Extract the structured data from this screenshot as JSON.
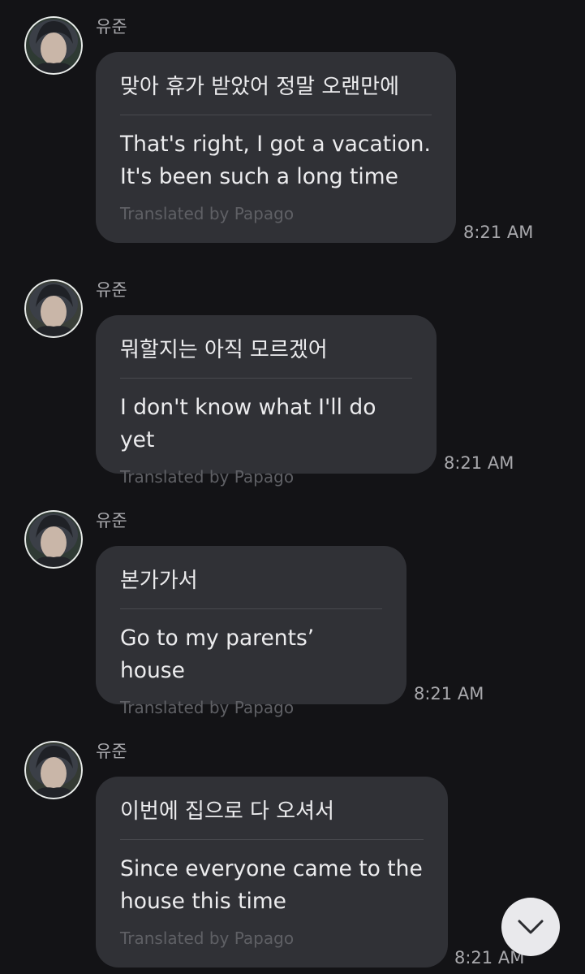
{
  "messages": [
    {
      "sender": "유준",
      "original": "맞아 휴가 받았어 정말 오랜만에",
      "translated_lines": [
        "That's right, I got a vacation.",
        "It's been such a long time"
      ],
      "credit": "Translated by Papago",
      "time": "8:21 AM"
    },
    {
      "sender": "유준",
      "original": "뭐할지는 아직 모르겠어",
      "translated_lines": [
        "I don't know what I'll do yet"
      ],
      "credit": "Translated by Papago",
      "time": "8:21 AM"
    },
    {
      "sender": "유준",
      "original": "본가가서",
      "translated_lines": [
        "Go to my parents’ house"
      ],
      "credit": "Translated by Papago",
      "time": "8:21 AM"
    },
    {
      "sender": "유준",
      "original": "이번에 집으로 다 오셔서",
      "translated_lines": [
        "Since everyone came to the",
        "house this time"
      ],
      "credit": "Translated by Papago",
      "time": "8:21 AM"
    }
  ],
  "scroll_button": {
    "icon": "chevron-down-icon"
  }
}
